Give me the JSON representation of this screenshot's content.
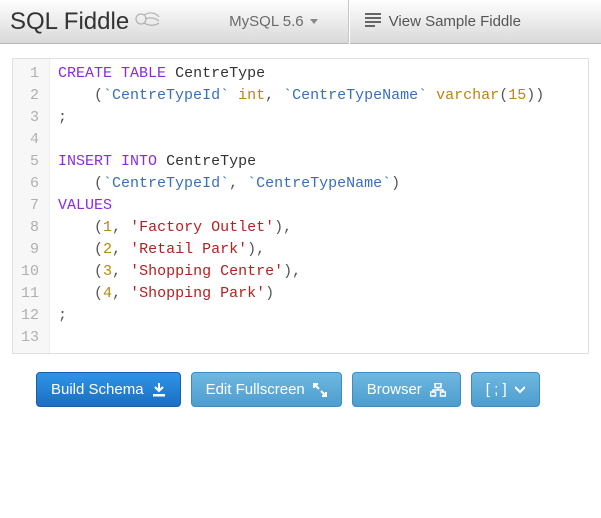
{
  "brand": "SQL Fiddle",
  "db_selector": {
    "label": "MySQL 5.6"
  },
  "sample_button": "View Sample Fiddle",
  "editor": {
    "lines": 13,
    "tokens": [
      [
        [
          "kw",
          "CREATE"
        ],
        [
          "sp",
          " "
        ],
        [
          "kw",
          "TABLE"
        ],
        [
          "sp",
          " "
        ],
        [
          "plain",
          "CentreType"
        ]
      ],
      [
        [
          "sp",
          "    "
        ],
        [
          "punc",
          "("
        ],
        [
          "id",
          "`CentreTypeId`"
        ],
        [
          "sp",
          " "
        ],
        [
          "ty",
          "int"
        ],
        [
          "punc",
          ", "
        ],
        [
          "id",
          "`CentreTypeName`"
        ],
        [
          "sp",
          " "
        ],
        [
          "ty",
          "varchar"
        ],
        [
          "punc",
          "("
        ],
        [
          "num",
          "15"
        ],
        [
          "punc",
          "))"
        ]
      ],
      [
        [
          "punc",
          ";"
        ]
      ],
      [],
      [
        [
          "kw",
          "INSERT"
        ],
        [
          "sp",
          " "
        ],
        [
          "kw",
          "INTO"
        ],
        [
          "sp",
          " "
        ],
        [
          "plain",
          "CentreType"
        ]
      ],
      [
        [
          "sp",
          "    "
        ],
        [
          "punc",
          "("
        ],
        [
          "id",
          "`CentreTypeId`"
        ],
        [
          "punc",
          ", "
        ],
        [
          "id",
          "`CentreTypeName`"
        ],
        [
          "punc",
          ")"
        ]
      ],
      [
        [
          "kw",
          "VALUES"
        ]
      ],
      [
        [
          "sp",
          "    "
        ],
        [
          "punc",
          "("
        ],
        [
          "num",
          "1"
        ],
        [
          "punc",
          ", "
        ],
        [
          "str",
          "'Factory Outlet'"
        ],
        [
          "punc",
          "),"
        ]
      ],
      [
        [
          "sp",
          "    "
        ],
        [
          "punc",
          "("
        ],
        [
          "num",
          "2"
        ],
        [
          "punc",
          ", "
        ],
        [
          "str",
          "'Retail Park'"
        ],
        [
          "punc",
          "),"
        ]
      ],
      [
        [
          "sp",
          "    "
        ],
        [
          "punc",
          "("
        ],
        [
          "num",
          "3"
        ],
        [
          "punc",
          ", "
        ],
        [
          "str",
          "'Shopping Centre'"
        ],
        [
          "punc",
          "),"
        ]
      ],
      [
        [
          "sp",
          "    "
        ],
        [
          "punc",
          "("
        ],
        [
          "num",
          "4"
        ],
        [
          "punc",
          ", "
        ],
        [
          "str",
          "'Shopping Park'"
        ],
        [
          "punc",
          ")"
        ]
      ],
      [
        [
          "punc",
          ";"
        ]
      ],
      []
    ]
  },
  "footer": {
    "build_schema": "Build Schema",
    "edit_fullscreen": "Edit Fullscreen",
    "browser": "Browser",
    "terminator": "[ ; ]"
  }
}
